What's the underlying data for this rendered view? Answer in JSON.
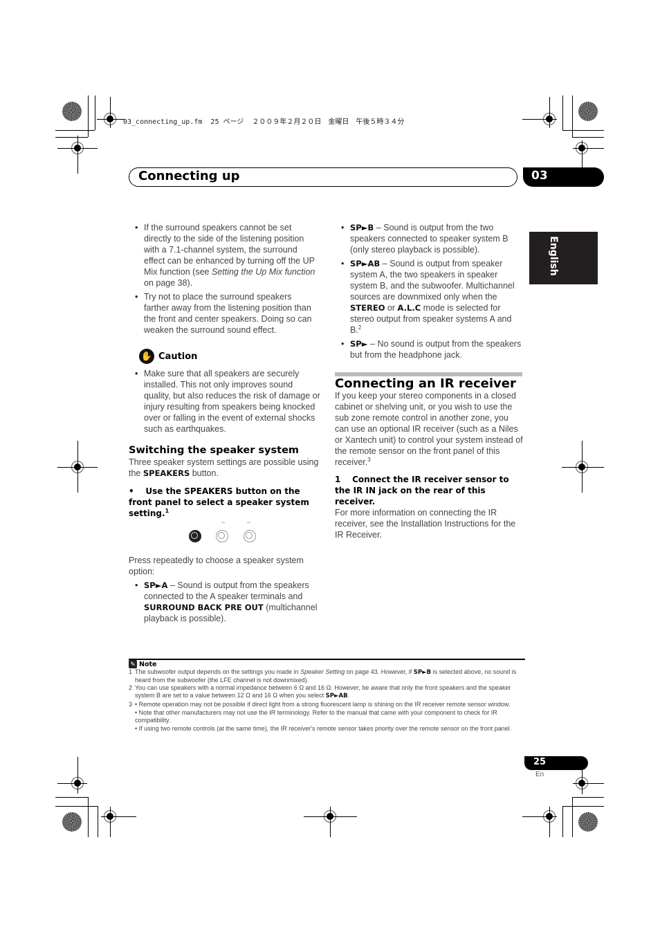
{
  "print_info": "03_connecting_up.fm  25 ページ  ２００９年２月２０日　金曜日　午後５時３４分",
  "header": {
    "title": "Connecting up",
    "chapter": "03"
  },
  "language_tab": "English",
  "left_column": {
    "bullets_top": [
      {
        "parts": [
          "If the surround speakers cannot be set directly to the side of the listening position with a 7.1-channel system, the surround effect can be enhanced by turning off the UP Mix function (see ",
          "Setting the Up Mix function",
          " on page 38)."
        ]
      },
      {
        "text": "Try not to place the surround speakers farther away from the listening position than the front and center speakers. Doing so can weaken the surround sound effect."
      }
    ],
    "caution": {
      "label": "Caution",
      "icon": "hand-stop-icon",
      "text": "Make sure that all speakers are securely installed. This not only improves sound quality, but also reduces the risk of damage or injury resulting from speakers being knocked over or falling in the event of external shocks such as earthquakes."
    },
    "section_title": "Switching the speaker system",
    "intro_pre": "Three speaker system settings are possible using the ",
    "intro_bold": "SPEAKERS",
    "intro_post": " button.",
    "instruction": "Use the SPEAKERS button on the front panel to select a speaker system setting.",
    "instruction_footnote": "1",
    "press_text": "Press repeatedly to choose a speaker system option:",
    "option_a": {
      "label": "SP►A",
      "text": " – Sound is output from the speakers connected to the A speaker terminals and ",
      "bold2": "SURROUND BACK PRE OUT",
      "text2": " (multichannel playback is possible)."
    }
  },
  "right_column": {
    "option_b": {
      "label": "SP►B",
      "text": " – Sound is output from the two speakers connected to speaker system B (only stereo playback is possible)."
    },
    "option_ab": {
      "label": "SP►AB",
      "text1": " – Sound is output from speaker system A, the two speakers in speaker system B, and the subwoofer. Multichannel sources are downmixed only when the ",
      "bold1": "STEREO",
      "text2": " or ",
      "bold2": "A.L.C",
      "text3": " mode is selected for stereo output from speaker systems A and B.",
      "footnote": "2"
    },
    "option_off": {
      "label": "SP►",
      "text": " – No sound is output from the speakers but from the headphone jack."
    },
    "section_title": "Connecting an IR receiver",
    "intro": "If you keep your stereo components in a closed cabinet or shelving unit, or you wish to use the sub zone remote control in another zone, you can use an optional IR receiver (such as a Niles or Xantech unit) to control your system instead of the remote sensor on the front panel of this receiver.",
    "intro_footnote": "3",
    "step_number": "1",
    "step_text": "Connect the IR receiver sensor to the IR IN jack on the rear of this receiver.",
    "step_detail": "For more information on connecting the IR receiver, see the Installation Instructions for the IR Receiver."
  },
  "notes": {
    "label": "Note",
    "icon": "pencil-note-icon",
    "items": [
      {
        "num": "1",
        "pre": "The subwoofer output depends on the settings you made in ",
        "italic": "Speaker Setting",
        "mid": " on page 43. However, if ",
        "bold": "SP►B",
        "post": " is selected above, no sound is heard from the subwoofer (the LFE channel is not downmixed)."
      },
      {
        "num": "2",
        "pre": "You can use speakers with a normal impedance between 6 Ω and 16 Ω. However, be aware that only the front speakers and the speaker system B are set to a value between 12 Ω and 16 Ω when you select ",
        "bold": "SP►AB",
        "post": "."
      },
      {
        "num": "3",
        "subs": [
          "• Remote operation may not be possible if direct light from a strong fluorescent lamp is shining on the IR receiver remote sensor window.",
          "• Note that other manufacturers may not use the IR terminology. Refer to the manual that came with your component to check for IR compatibility.",
          "• If using two remote controls (at the same time), the IR receiver's remote sensor takes priority over the remote sensor on the front panel."
        ]
      }
    ]
  },
  "footer": {
    "page_number": "25",
    "language": "En"
  }
}
